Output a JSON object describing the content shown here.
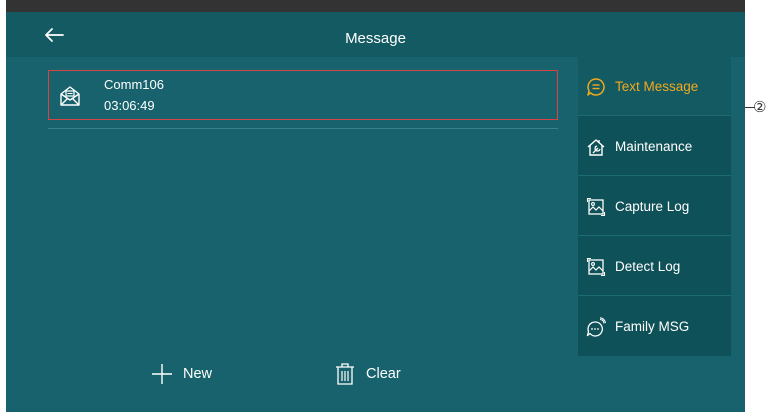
{
  "header": {
    "title": "Message"
  },
  "messages": [
    {
      "name": "Comm106",
      "time": "03:06:49"
    }
  ],
  "sidebar": {
    "items": [
      {
        "label": "Text Message",
        "icon": "text-message-icon",
        "active": true
      },
      {
        "label": "Maintenance",
        "icon": "maintenance-icon",
        "active": false
      },
      {
        "label": "Capture Log",
        "icon": "capture-log-icon",
        "active": false
      },
      {
        "label": "Detect Log",
        "icon": "detect-log-icon",
        "active": false
      },
      {
        "label": "Family MSG",
        "icon": "family-msg-icon",
        "active": false
      }
    ]
  },
  "bottom": {
    "new_label": "New",
    "clear_label": "Clear"
  },
  "callout": {
    "marker": "②"
  },
  "colors": {
    "background": "#17626c",
    "header": "#135a63",
    "sidebar": "#0f5158",
    "active_text": "#f2a81d",
    "highlight_border": "#d64545",
    "text": "#ffffff"
  }
}
